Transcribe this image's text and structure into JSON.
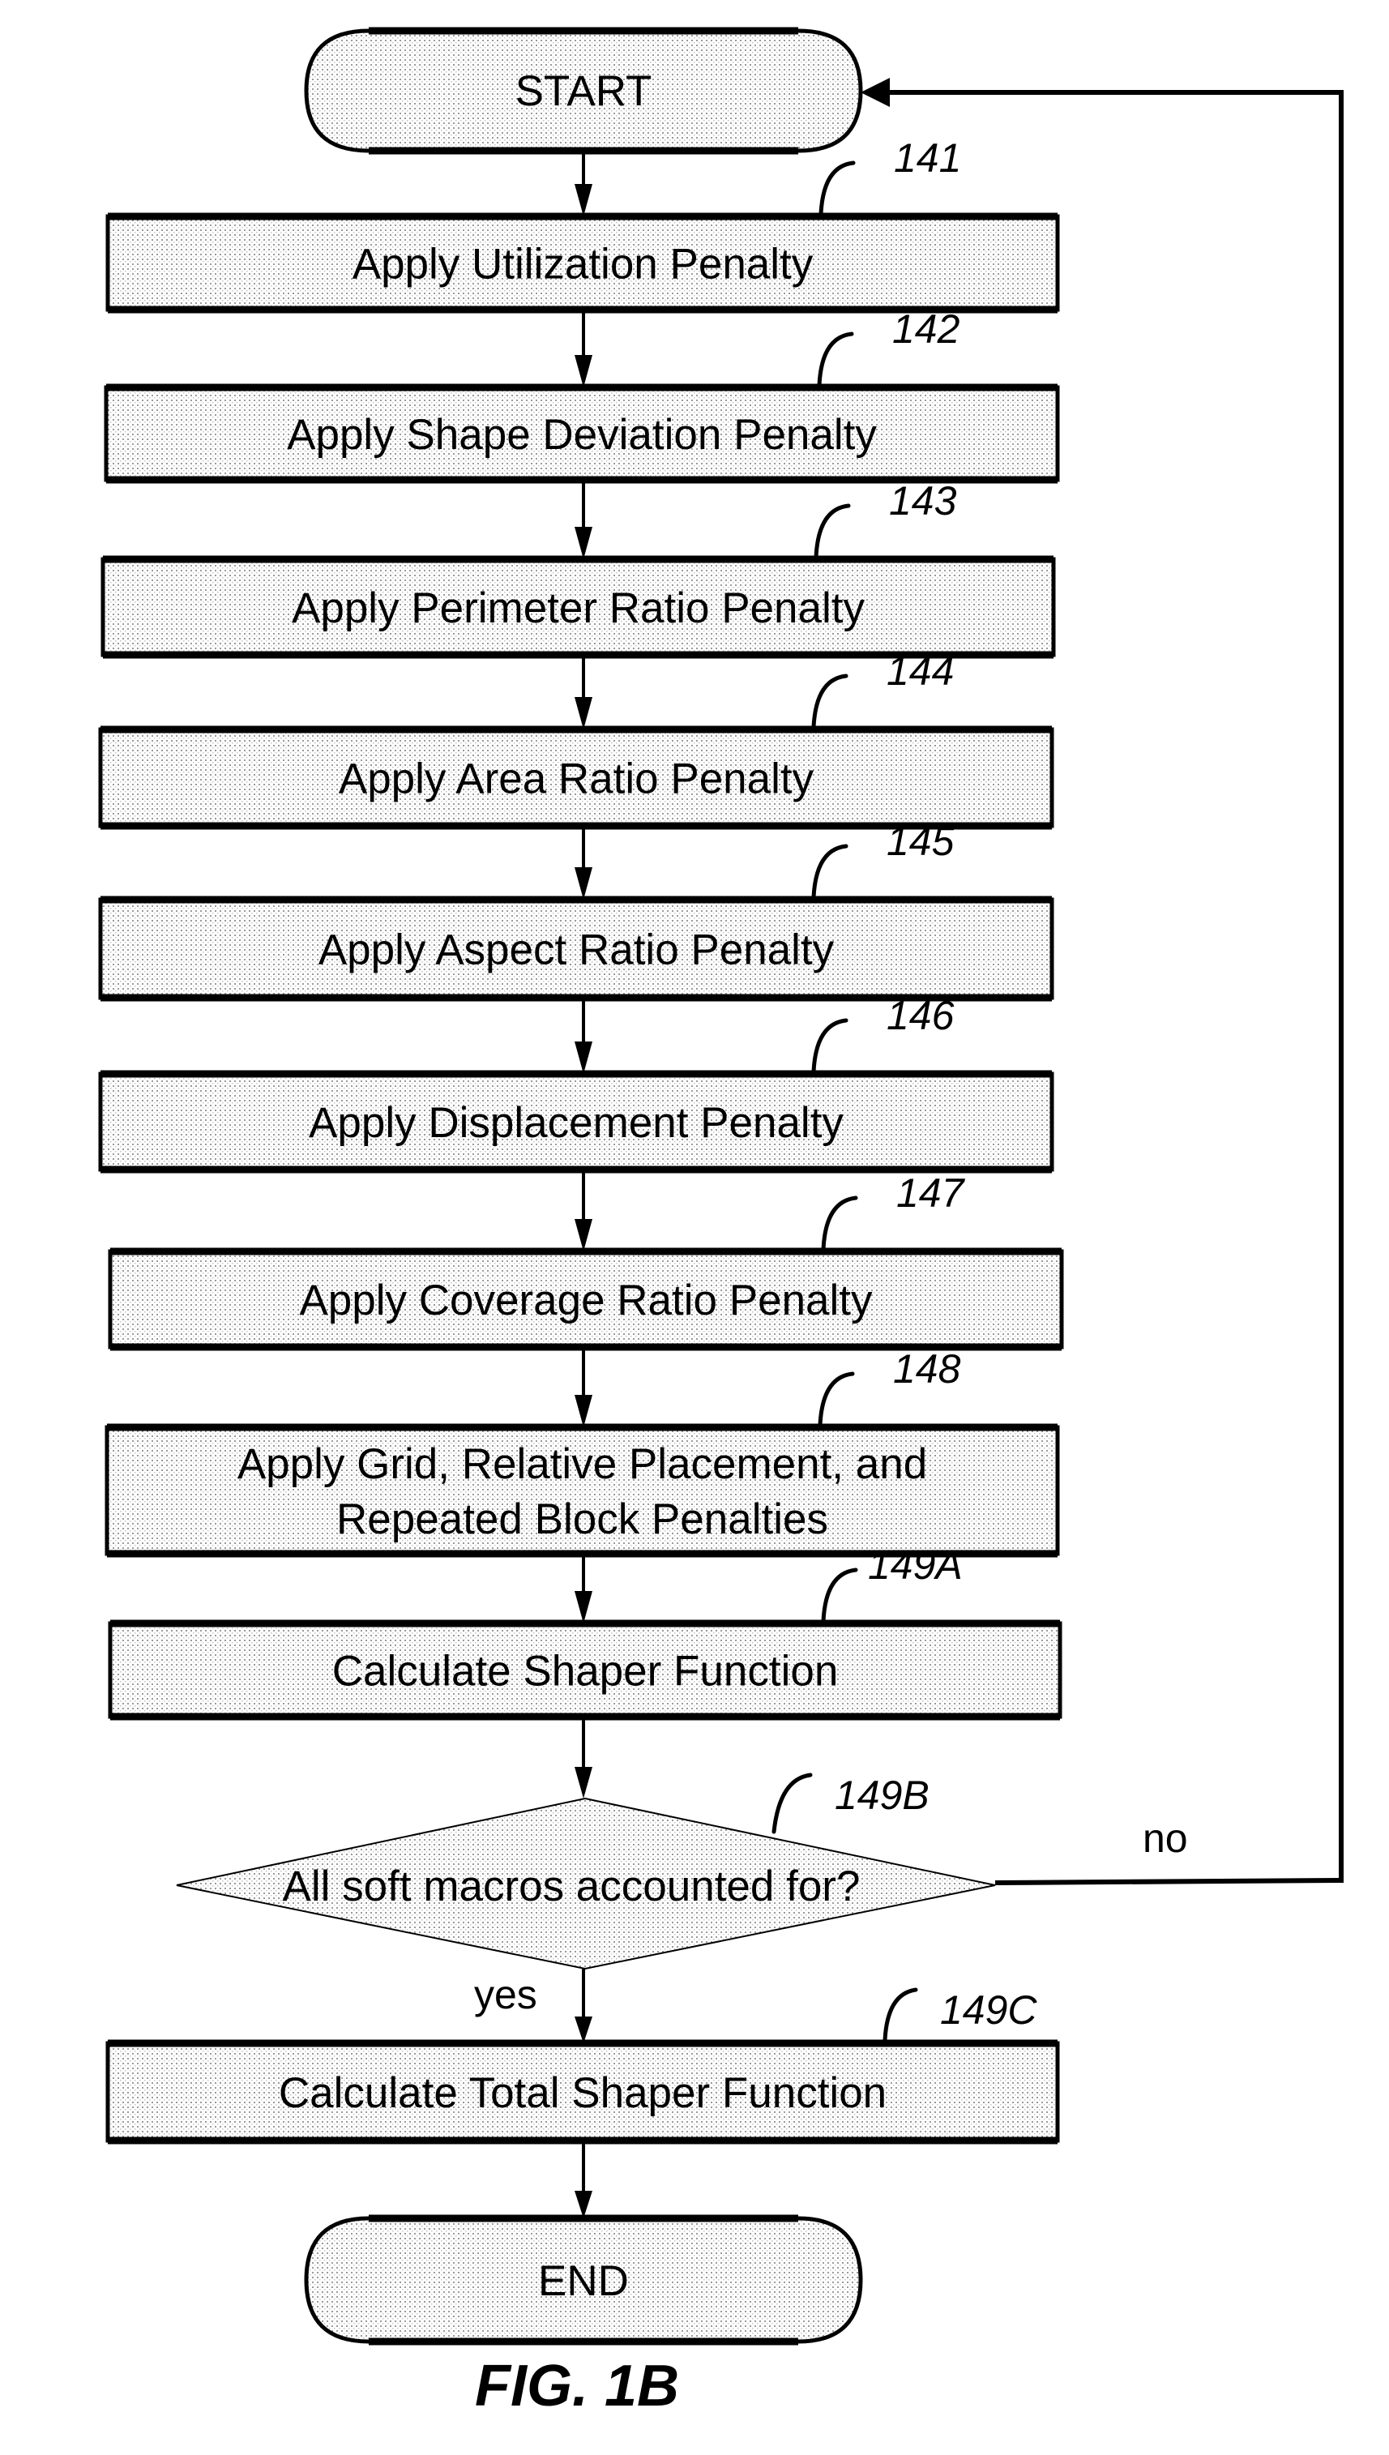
{
  "figure": {
    "caption": "FIG. 1B",
    "terminals": {
      "start": "START",
      "end": "END"
    },
    "steps": [
      {
        "ref": "141",
        "lines": [
          "Apply Utilization Penalty"
        ]
      },
      {
        "ref": "142",
        "lines": [
          "Apply Shape Deviation Penalty"
        ]
      },
      {
        "ref": "143",
        "lines": [
          "Apply Perimeter Ratio Penalty"
        ]
      },
      {
        "ref": "144",
        "lines": [
          "Apply Area Ratio Penalty"
        ]
      },
      {
        "ref": "145",
        "lines": [
          "Apply Aspect Ratio Penalty"
        ]
      },
      {
        "ref": "146",
        "lines": [
          "Apply Displacement Penalty"
        ]
      },
      {
        "ref": "147",
        "lines": [
          "Apply Coverage Ratio Penalty"
        ]
      },
      {
        "ref": "148",
        "lines": [
          "Apply Grid, Relative Placement, and",
          "Repeated Block Penalties"
        ]
      },
      {
        "ref": "149A",
        "lines": [
          "Calculate Shaper Function"
        ]
      }
    ],
    "decision": {
      "ref": "149B",
      "question": "All soft macros accounted for?",
      "no_label": "no",
      "yes_label": "yes"
    },
    "final_step": {
      "ref": "149C",
      "lines": [
        "Calculate Total Shaper Function"
      ]
    }
  }
}
